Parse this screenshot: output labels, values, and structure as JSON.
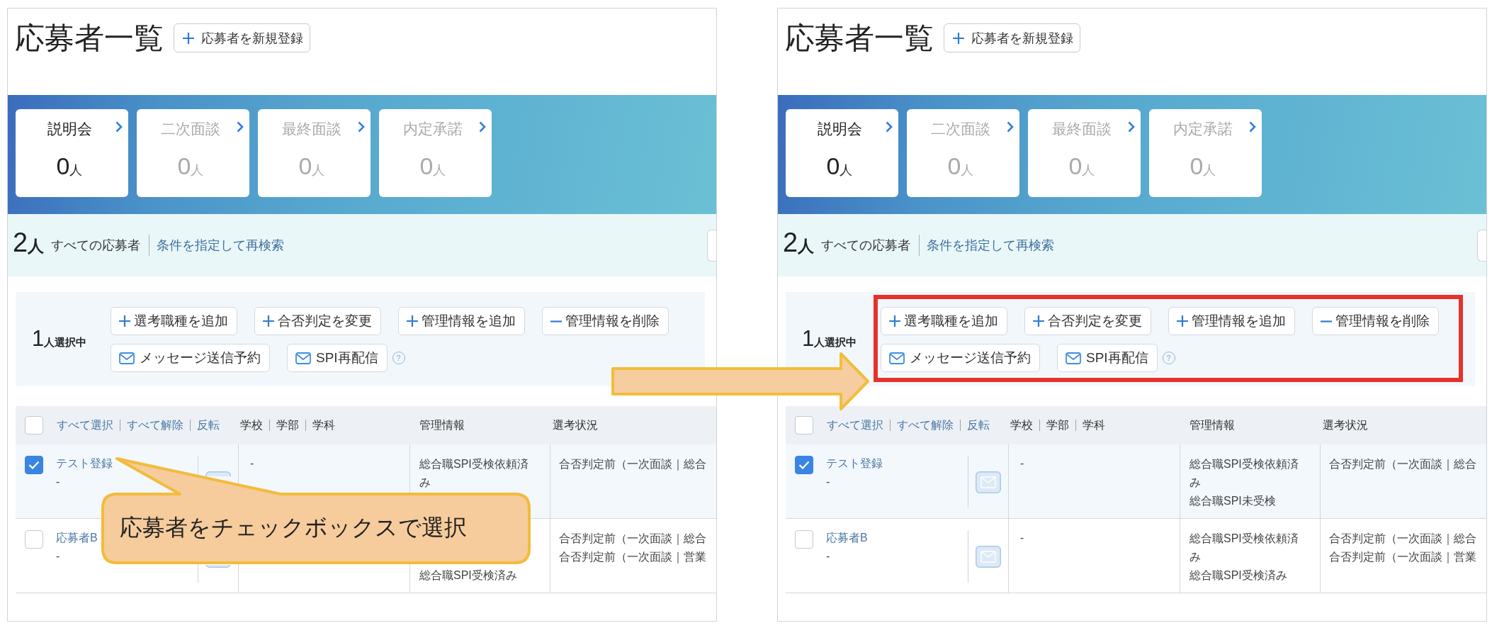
{
  "panels": [
    {
      "title": "応募者一覧",
      "new_button": "応募者を新規登録",
      "stages": [
        {
          "label": "説明会",
          "count": "0",
          "unit": "人",
          "selected": true
        },
        {
          "label": "二次面談",
          "count": "0",
          "unit": "人",
          "selected": false
        },
        {
          "label": "最終面談",
          "count": "0",
          "unit": "人",
          "selected": false
        },
        {
          "label": "内定承諾",
          "count": "0",
          "unit": "人",
          "selected": false
        }
      ],
      "summary": {
        "count": "2",
        "unit": "人",
        "label": "すべての応募者",
        "link": "条件を指定して再検索"
      },
      "selection": {
        "count": "1",
        "unit": "人選択中",
        "highlighted": false,
        "actions": [
          {
            "kind": "add",
            "label": "選考職種を追加"
          },
          {
            "kind": "add",
            "label": "合否判定を変更"
          },
          {
            "kind": "add",
            "label": "管理情報を追加"
          },
          {
            "kind": "remove",
            "label": "管理情報を削除"
          },
          {
            "kind": "mail",
            "label": "メッセージ送信予約"
          },
          {
            "kind": "mail",
            "label": "SPI再配信"
          }
        ],
        "help_icon": "?"
      },
      "table": {
        "all_checked": false,
        "bulk_links": [
          "すべて選択",
          "すべて解除",
          "反転"
        ],
        "school_header": [
          "学校",
          "学部",
          "学科"
        ],
        "columns": [
          "管理情報",
          "選考状況"
        ],
        "rows": [
          {
            "checked": true,
            "name": "テスト登録",
            "note": "-",
            "message_button": {
              "disabled": true
            },
            "school": "-",
            "spi_request": "総合職SPI受検依頼済み",
            "status": [
              "合否判定前（一次面談｜総合"
            ]
          },
          {
            "checked": false,
            "name": "応募者B",
            "note": "-",
            "message_button": {
              "disabled": true
            },
            "spi_test": "総合職SPI受検済み",
            "status": [
              "合否判定前（一次面談｜総合",
              "合否判定前（一次面談｜営業"
            ]
          }
        ]
      }
    },
    {
      "title": "応募者一覧",
      "new_button": "応募者を新規登録",
      "stages": [
        {
          "label": "説明会",
          "count": "0",
          "unit": "人",
          "selected": true
        },
        {
          "label": "二次面談",
          "count": "0",
          "unit": "人",
          "selected": false
        },
        {
          "label": "最終面談",
          "count": "0",
          "unit": "人",
          "selected": false
        },
        {
          "label": "内定承諾",
          "count": "0",
          "unit": "人",
          "selected": false
        }
      ],
      "summary": {
        "count": "2",
        "unit": "人",
        "label": "すべての応募者",
        "link": "条件を指定して再検索"
      },
      "selection": {
        "count": "1",
        "unit": "人選択中",
        "highlighted": true,
        "actions": [
          {
            "kind": "add",
            "label": "選考職種を追加"
          },
          {
            "kind": "add",
            "label": "合否判定を変更"
          },
          {
            "kind": "add",
            "label": "管理情報を追加"
          },
          {
            "kind": "remove",
            "label": "管理情報を削除"
          },
          {
            "kind": "mail",
            "label": "メッセージ送信予約"
          },
          {
            "kind": "mail",
            "label": "SPI再配信"
          }
        ],
        "help_icon": "?"
      },
      "table": {
        "all_checked": false,
        "bulk_links": [
          "すべて選択",
          "すべて解除",
          "反転"
        ],
        "school_header": [
          "学校",
          "学部",
          "学科"
        ],
        "columns": [
          "管理情報",
          "選考状況"
        ],
        "rows": [
          {
            "checked": true,
            "name": "テスト登録",
            "note": "-",
            "message_button": {
              "disabled": true
            },
            "school": "-",
            "spi_request": "総合職SPI受検依頼済み",
            "spi_test": "総合職SPI未受検",
            "status": [
              "合否判定前（一次面談｜総合"
            ]
          },
          {
            "checked": false,
            "name": "応募者B",
            "note": "-",
            "message_button": {
              "disabled": true
            },
            "school": "-",
            "spi_request": "総合職SPI受検依頼済み",
            "spi_test": "総合職SPI受検済み",
            "status": [
              "合否判定前（一次面談｜総合",
              "合否判定前（一次面談｜営業"
            ]
          }
        ]
      }
    }
  ],
  "callout": {
    "text": "応募者をチェックボックスで選択"
  }
}
